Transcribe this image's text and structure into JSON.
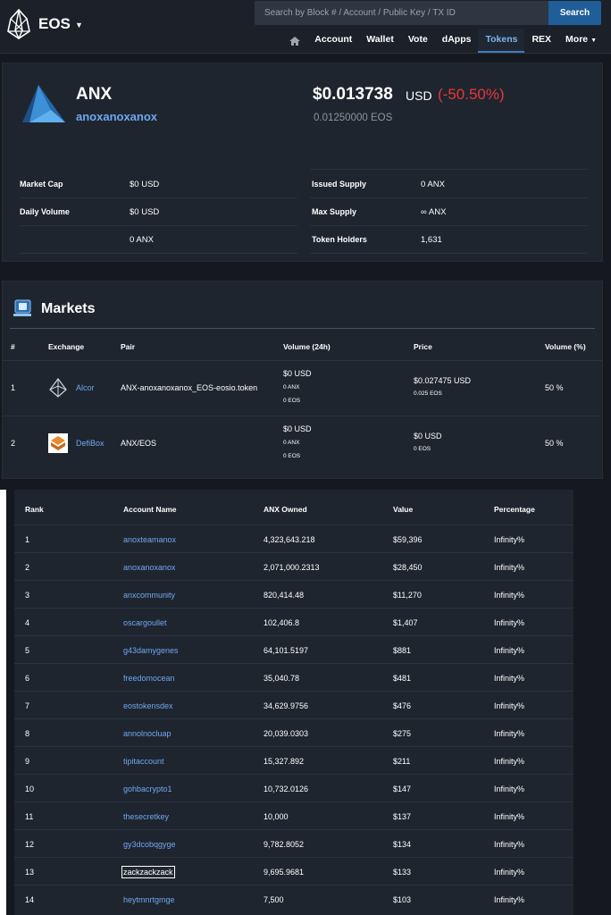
{
  "header": {
    "brand": "EOS",
    "search_placeholder": "Search by Block # / Account / Public Key / TX ID",
    "search_button": "Search",
    "nav": [
      "Account",
      "Wallet",
      "Vote",
      "dApps",
      "Tokens",
      "REX",
      "More"
    ],
    "active_nav": "Tokens"
  },
  "token": {
    "symbol": "ANX",
    "account": "anoxanoxanox",
    "price_usd": "$0.013738",
    "price_unit": "USD",
    "price_change": "(-50.50%)",
    "price_eos": "0.01250000 EOS",
    "stats_left": [
      {
        "label": "Market Cap",
        "value": "$0 USD"
      },
      {
        "label": "Daily Volume",
        "value": "$0 USD"
      },
      {
        "label": "",
        "value": "0 ANX"
      }
    ],
    "stats_right": [
      {
        "label": "Issued Supply",
        "value": "0 ANX"
      },
      {
        "label": "Max Supply",
        "value": "∞ ANX"
      },
      {
        "label": "Token Holders",
        "value": "1,631"
      }
    ]
  },
  "markets": {
    "title": "Markets",
    "headers": [
      "#",
      "Exchange",
      "Pair",
      "Volume (24h)",
      "Price",
      "Volume (%)"
    ],
    "rows": [
      {
        "num": "1",
        "exchange": "Alcor",
        "pair": "ANX-anoxanoxanox_EOS-eosio.token",
        "vol_usd": "$0 USD",
        "vol_token": "0 ANX",
        "vol_eos": "0 EOS",
        "price_usd": "$0.027475 USD",
        "price_eos": "0.025 EOS",
        "vol_pct": "50 %"
      },
      {
        "num": "2",
        "exchange": "DefiBox",
        "pair": "ANX/EOS",
        "vol_usd": "$0 USD",
        "vol_token": "0 ANX",
        "vol_eos": "0 EOS",
        "price_usd": "$0 USD",
        "price_eos": "0 EOS",
        "vol_pct": "50 %"
      }
    ]
  },
  "holders": {
    "headers": [
      "Rank",
      "Account Name",
      "ANX Owned",
      "Value",
      "Percentage"
    ],
    "rows": [
      {
        "rank": "1",
        "account": "anoxteamanox",
        "owned": "4,323,643.218",
        "value": "$59,396",
        "pct": "Infinity%"
      },
      {
        "rank": "2",
        "account": "anoxanoxanox",
        "owned": "2,071,000.2313",
        "value": "$28,450",
        "pct": "Infinity%"
      },
      {
        "rank": "3",
        "account": "anxcommunity",
        "owned": "820,414.48",
        "value": "$11,270",
        "pct": "Infinity%"
      },
      {
        "rank": "4",
        "account": "oscargoullet",
        "owned": "102,406.8",
        "value": "$1,407",
        "pct": "Infinity%"
      },
      {
        "rank": "5",
        "account": "g43damygenes",
        "owned": "64,101.5197",
        "value": "$881",
        "pct": "Infinity%"
      },
      {
        "rank": "6",
        "account": "freedomocean",
        "owned": "35,040.78",
        "value": "$481",
        "pct": "Infinity%"
      },
      {
        "rank": "7",
        "account": "eostokensdex",
        "owned": "34,629.9756",
        "value": "$476",
        "pct": "Infinity%"
      },
      {
        "rank": "8",
        "account": "annolnocluap",
        "owned": "20,039.0303",
        "value": "$275",
        "pct": "Infinity%"
      },
      {
        "rank": "9",
        "account": "tipitaccount",
        "owned": "15,327.892",
        "value": "$211",
        "pct": "Infinity%"
      },
      {
        "rank": "10",
        "account": "gohbacrypto1",
        "owned": "10,732.0126",
        "value": "$147",
        "pct": "Infinity%"
      },
      {
        "rank": "11",
        "account": "thesecretkey",
        "owned": "10,000",
        "value": "$137",
        "pct": "Infinity%"
      },
      {
        "rank": "12",
        "account": "gy3dcobqgyge",
        "owned": "9,782.8052",
        "value": "$134",
        "pct": "Infinity%"
      },
      {
        "rank": "13",
        "account": "zackzackzack",
        "owned": "9,695.9681",
        "value": "$133",
        "pct": "Infinity%"
      },
      {
        "rank": "14",
        "account": "heytmnrtgmge",
        "owned": "7,500",
        "value": "$103",
        "pct": "Infinity%"
      }
    ],
    "selected_rank": "13"
  },
  "colors": {
    "accent": "#6ea8f2",
    "negative": "#e9363b",
    "panel": "#1f252e",
    "background": "#15191f",
    "search_button": "#1f5e98"
  }
}
